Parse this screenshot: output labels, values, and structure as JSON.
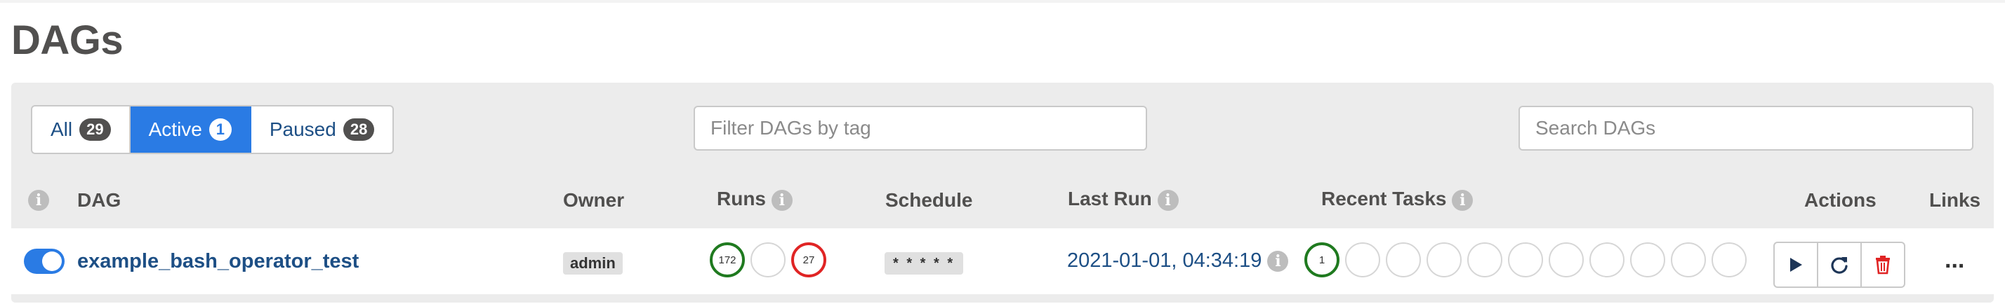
{
  "page": {
    "title": "DAGs"
  },
  "filters": {
    "all": {
      "label": "All",
      "count": "29"
    },
    "active": {
      "label": "Active",
      "count": "1"
    },
    "paused": {
      "label": "Paused",
      "count": "28"
    }
  },
  "tag_filter": {
    "placeholder": "Filter DAGs by tag",
    "value": ""
  },
  "search": {
    "placeholder": "Search DAGs",
    "value": ""
  },
  "table": {
    "headers": {
      "info": "i",
      "dag": "DAG",
      "owner": "Owner",
      "runs": "Runs",
      "schedule": "Schedule",
      "last_run": "Last Run",
      "recent_tasks": "Recent Tasks",
      "actions": "Actions",
      "links": "Links"
    },
    "rows": [
      {
        "paused_toggle": "on",
        "dag_id": "example_bash_operator_test",
        "owner": "admin",
        "runs": [
          {
            "state": "success",
            "count": "172"
          },
          {
            "state": "running",
            "count": ""
          },
          {
            "state": "failed",
            "count": "27"
          }
        ],
        "schedule": "* * * * *",
        "last_run": "2021-01-01, 04:34:19",
        "recent_tasks": [
          {
            "state": "success",
            "count": "1"
          },
          {
            "state": "none",
            "count": ""
          },
          {
            "state": "none",
            "count": ""
          },
          {
            "state": "none",
            "count": ""
          },
          {
            "state": "none",
            "count": ""
          },
          {
            "state": "none",
            "count": ""
          },
          {
            "state": "none",
            "count": ""
          },
          {
            "state": "none",
            "count": ""
          },
          {
            "state": "none",
            "count": ""
          },
          {
            "state": "none",
            "count": ""
          },
          {
            "state": "none",
            "count": ""
          }
        ],
        "actions": [
          "play-icon",
          "refresh-icon",
          "trash-icon"
        ],
        "links": "..."
      }
    ]
  },
  "colors": {
    "accent": "#2a7be4",
    "link": "#1d4f85",
    "success": "#1f7a1f",
    "failed": "#e02424",
    "delete": "#e02424"
  }
}
